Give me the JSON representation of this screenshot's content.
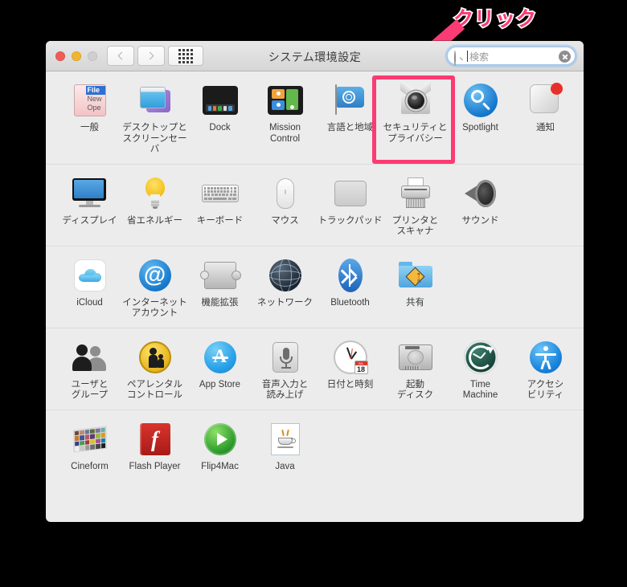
{
  "annotation": {
    "text": "クリック",
    "color": "#fb3b73",
    "arrow_name": "pink-arrow"
  },
  "window": {
    "title": "システム環境設定",
    "traffic_lights": [
      "close",
      "minimize",
      "zoom"
    ],
    "nav": {
      "back": "◀",
      "forward": "▶",
      "grid": "show-all"
    },
    "search": {
      "placeholder": "検索",
      "value": "",
      "clear_label": "✕"
    }
  },
  "highlight": {
    "target": "セキュリティとプライバシー",
    "color": "#fb3b73"
  },
  "rows": [
    {
      "name": "personal",
      "items": [
        {
          "label": "一般",
          "icon": "general-icon"
        },
        {
          "label": "デスクトップと\nスクリーンセーバ",
          "icon": "desktop-screensaver-icon"
        },
        {
          "label": "Dock",
          "icon": "dock-icon"
        },
        {
          "label": "Mission\nControl",
          "icon": "mission-control-icon"
        },
        {
          "label": "言語と地域",
          "icon": "language-region-icon"
        },
        {
          "label": "セキュリティと\nプライバシー",
          "icon": "security-privacy-icon"
        },
        {
          "label": "Spotlight",
          "icon": "spotlight-icon"
        },
        {
          "label": "通知",
          "icon": "notifications-icon"
        }
      ]
    },
    {
      "name": "hardware",
      "items": [
        {
          "label": "ディスプレイ",
          "icon": "displays-icon"
        },
        {
          "label": "省エネルギー",
          "icon": "energy-saver-icon"
        },
        {
          "label": "キーボード",
          "icon": "keyboard-icon"
        },
        {
          "label": "マウス",
          "icon": "mouse-icon"
        },
        {
          "label": "トラックパッド",
          "icon": "trackpad-icon"
        },
        {
          "label": "プリンタと\nスキャナ",
          "icon": "printers-scanners-icon"
        },
        {
          "label": "サウンド",
          "icon": "sound-icon"
        }
      ]
    },
    {
      "name": "internet-wireless",
      "items": [
        {
          "label": "iCloud",
          "icon": "icloud-icon"
        },
        {
          "label": "インターネット\nアカウント",
          "icon": "internet-accounts-icon"
        },
        {
          "label": "機能拡張",
          "icon": "extensions-icon"
        },
        {
          "label": "ネットワーク",
          "icon": "network-icon"
        },
        {
          "label": "Bluetooth",
          "icon": "bluetooth-icon"
        },
        {
          "label": "共有",
          "icon": "sharing-icon"
        }
      ]
    },
    {
      "name": "system",
      "items": [
        {
          "label": "ユーザと\nグループ",
          "icon": "users-groups-icon"
        },
        {
          "label": "ペアレンタル\nコントロール",
          "icon": "parental-controls-icon"
        },
        {
          "label": "App Store",
          "icon": "app-store-icon"
        },
        {
          "label": "音声入力と\n読み上げ",
          "icon": "dictation-speech-icon"
        },
        {
          "label": "日付と時刻",
          "icon": "date-time-icon"
        },
        {
          "label": "起動\nディスク",
          "icon": "startup-disk-icon"
        },
        {
          "label": "Time\nMachine",
          "icon": "time-machine-icon"
        },
        {
          "label": "アクセシ\nビリティ",
          "icon": "accessibility-icon"
        }
      ]
    },
    {
      "name": "third-party",
      "items": [
        {
          "label": "Cineform",
          "icon": "cineform-icon"
        },
        {
          "label": "Flash Player",
          "icon": "flash-player-icon"
        },
        {
          "label": "Flip4Mac",
          "icon": "flip4mac-icon"
        },
        {
          "label": "Java",
          "icon": "java-icon"
        }
      ]
    }
  ],
  "general_icon_menu": {
    "row1": "File",
    "row2": "New",
    "row3": "Ope"
  },
  "date_time_icon": {
    "month": "JUL",
    "day": "18"
  },
  "cineform_colors": [
    "#6e4b3a",
    "#c08a6e",
    "#5a7ca8",
    "#5c6b3c",
    "#7a74a0",
    "#62b2a4",
    "#c6762a",
    "#42529c",
    "#b85660",
    "#5a3d6e",
    "#9cb83e",
    "#d99a22",
    "#2f3f8e",
    "#4f9a4e",
    "#a8333a",
    "#d9c22c",
    "#a8519a",
    "#0f7fa8",
    "#f0f0ee",
    "#c8c8c6",
    "#9a9a98",
    "#6e6e6c",
    "#454544",
    "#1e1e1e"
  ]
}
